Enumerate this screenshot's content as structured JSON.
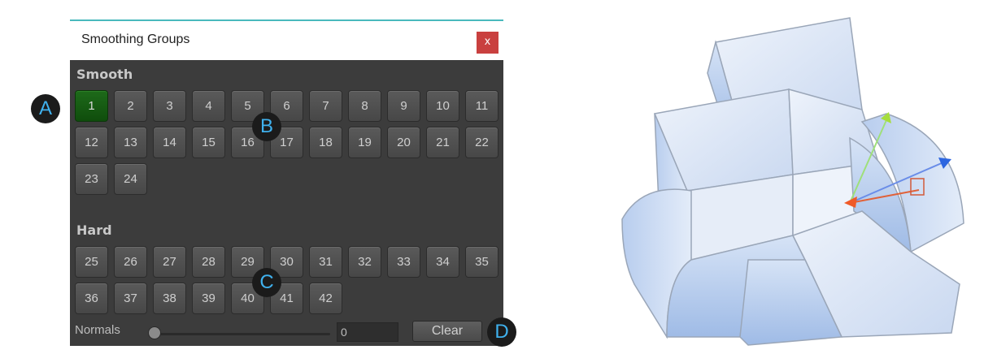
{
  "window": {
    "title": "Smoothing Groups",
    "close_glyph": "x"
  },
  "smooth": {
    "label": "Smooth",
    "groups": [
      "1",
      "2",
      "3",
      "4",
      "5",
      "6",
      "7",
      "8",
      "9",
      "10",
      "11",
      "12",
      "13",
      "14",
      "15",
      "16",
      "17",
      "18",
      "19",
      "20",
      "21",
      "22",
      "23",
      "24"
    ],
    "active_group": "1"
  },
  "hard": {
    "label": "Hard",
    "groups": [
      "25",
      "26",
      "27",
      "28",
      "29",
      "30",
      "31",
      "32",
      "33",
      "34",
      "35",
      "36",
      "37",
      "38",
      "39",
      "40",
      "41",
      "42"
    ]
  },
  "normals": {
    "label": "Normals",
    "value": "0"
  },
  "clear_label": "Clear",
  "callouts": {
    "a": "A",
    "b": "B",
    "c": "C",
    "d": "D"
  },
  "colors": {
    "active_green": "#1e6a1a",
    "callout_text": "#3fb1ee",
    "close_red": "#c9403f",
    "accent_teal": "#49b9bd"
  }
}
